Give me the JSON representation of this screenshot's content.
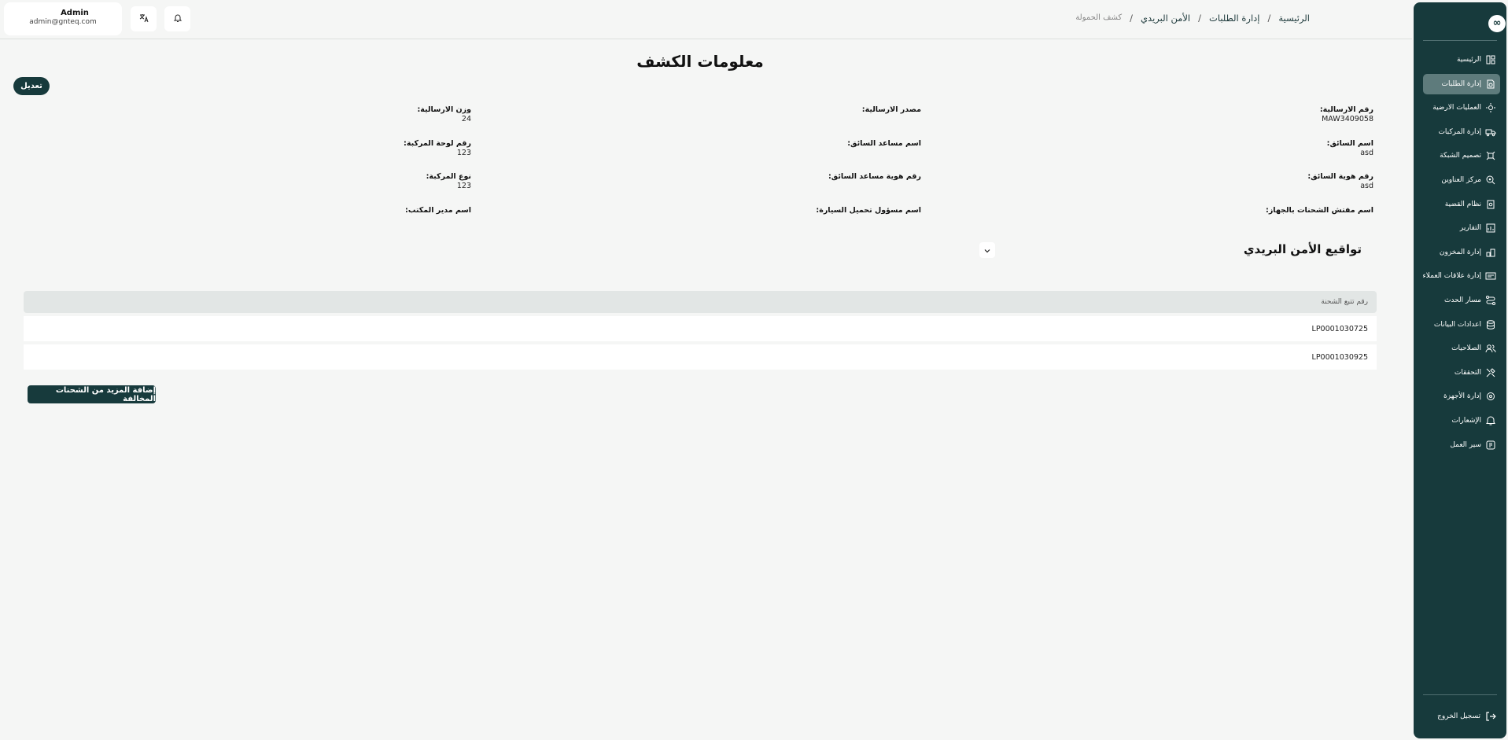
{
  "header": {
    "user": {
      "name": "Admin",
      "email": "admin@gnteq.com"
    },
    "breadcrumb": [
      "الرئيسية",
      "إدارة الطلبات",
      "الأمن البريدي",
      "كشف الحمولة"
    ],
    "separator": "/"
  },
  "sidebar": {
    "logo": "∞",
    "items": [
      {
        "label": "الرئيسية",
        "icon": "layout-icon"
      },
      {
        "label": "إدارة الطلبات",
        "icon": "orders-icon",
        "active": true
      },
      {
        "label": "العمليات الارضية",
        "icon": "ground-ops-icon"
      },
      {
        "label": "إدارة المركبات",
        "icon": "truck-icon"
      },
      {
        "label": "تصميم الشبكة",
        "icon": "network-icon"
      },
      {
        "label": "مركز العناوين",
        "icon": "location-icon"
      },
      {
        "label": "نظام القضية",
        "icon": "case-icon"
      },
      {
        "label": "التقارير",
        "icon": "report-icon"
      },
      {
        "label": "إدارة المخزون",
        "icon": "inventory-icon"
      },
      {
        "label": "إدارة علاقات العملاء",
        "icon": "crm-icon"
      },
      {
        "label": "مسار الحدث",
        "icon": "route-icon"
      },
      {
        "label": "اعدادات البيانات",
        "icon": "database-icon"
      },
      {
        "label": "الصلاحيات",
        "icon": "users-icon"
      },
      {
        "label": "التحققات",
        "icon": "tools-icon"
      },
      {
        "label": "إدارة الأجهزة",
        "icon": "device-icon"
      },
      {
        "label": "الإشعارات",
        "icon": "bell-icon"
      },
      {
        "label": "سير العمل",
        "icon": "workflow-icon"
      }
    ],
    "logout": "تسجيل الخروج"
  },
  "main": {
    "title": "معلومات الكشف",
    "edit_label": "تعديل",
    "fields": {
      "shipment_number": {
        "label": "رقم الارسالية:",
        "value": "MAW3409058"
      },
      "shipment_source": {
        "label": "مصدر الارسالية:",
        "value": ""
      },
      "shipment_weight": {
        "label": "وزن الارسالية:",
        "value": "24"
      },
      "driver_name": {
        "label": "اسم السائق:",
        "value": "asd"
      },
      "driver_assistant_name": {
        "label": "اسم مساعد السائق:",
        "value": ""
      },
      "vehicle_plate": {
        "label": "رقم لوحة المركبة:",
        "value": "123"
      },
      "driver_id": {
        "label": "رقم هوية السائق:",
        "value": "asd"
      },
      "assistant_id": {
        "label": "رقم هوية مساعد السائق:",
        "value": ""
      },
      "vehicle_type": {
        "label": "نوع المركبة:",
        "value": "123"
      },
      "inspector_name": {
        "label": "اسم مفتش الشحنات بالجهاز:",
        "value": ""
      },
      "loading_officer": {
        "label": "اسم مسؤول تحميل السيارة:",
        "value": ""
      },
      "office_manager": {
        "label": "اسم مدير المكتب:",
        "value": ""
      }
    },
    "signatures_title": "تواقيع الأمن البريدي",
    "table": {
      "header": "رقم تتبع الشحنة",
      "rows": [
        "LP0001030725",
        "LP0001030925"
      ]
    },
    "add_more_label": "إضافة المزيد من الشحنات المخالفة"
  }
}
